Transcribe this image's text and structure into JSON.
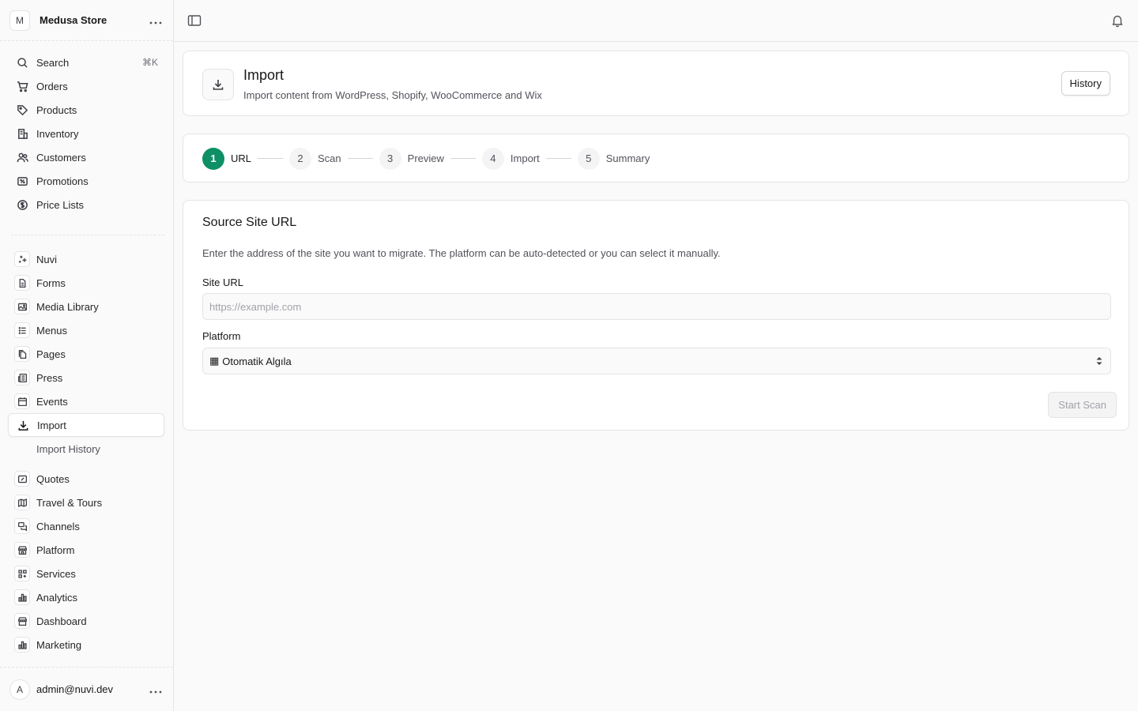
{
  "store": {
    "avatar_letter": "M",
    "name": "Medusa Store",
    "menu_icon": "ellipsis-icon"
  },
  "search": {
    "label": "Search",
    "shortcut": "⌘K"
  },
  "nav_main": [
    {
      "label": "Orders",
      "icon": "cart-icon"
    },
    {
      "label": "Products",
      "icon": "tag-icon"
    },
    {
      "label": "Inventory",
      "icon": "building-icon"
    },
    {
      "label": "Customers",
      "icon": "users-icon"
    },
    {
      "label": "Promotions",
      "icon": "receipt-percent-icon"
    },
    {
      "label": "Price Lists",
      "icon": "currency-dollar-icon"
    }
  ],
  "nav_extensions": [
    {
      "label": "Nuvi",
      "icon": "sparkles-icon"
    },
    {
      "label": "Forms",
      "icon": "document-icon"
    },
    {
      "label": "Media Library",
      "icon": "photo-icon"
    },
    {
      "label": "Menus",
      "icon": "list-bullet-icon"
    },
    {
      "label": "Pages",
      "icon": "documents-icon"
    },
    {
      "label": "Press",
      "icon": "newspaper-icon"
    },
    {
      "label": "Events",
      "icon": "calendar-icon"
    },
    {
      "label": "Import",
      "icon": "download-icon",
      "active": true
    }
  ],
  "nav_import_sub": "Import History",
  "nav_more": [
    {
      "label": "Quotes",
      "icon": "receipt-percent-icon"
    },
    {
      "label": "Travel & Tours",
      "icon": "map-icon"
    },
    {
      "label": "Channels",
      "icon": "chat-bubbles-icon"
    },
    {
      "label": "Platform",
      "icon": "building-storefront-icon"
    },
    {
      "label": "Services",
      "icon": "squares-plus-icon"
    },
    {
      "label": "Analytics",
      "icon": "chart-bar-icon"
    },
    {
      "label": "Dashboard",
      "icon": "building-storefront-icon"
    },
    {
      "label": "Marketing",
      "icon": "chart-bar-icon"
    }
  ],
  "user": {
    "avatar_letter": "A",
    "email": "admin@nuvi.dev"
  },
  "page_header": {
    "title": "Import",
    "subtitle": "Import content from WordPress, Shopify, WooCommerce and Wix",
    "history_button": "History"
  },
  "steps": [
    {
      "number": "1",
      "label": "URL",
      "active": true
    },
    {
      "number": "2",
      "label": "Scan"
    },
    {
      "number": "3",
      "label": "Preview"
    },
    {
      "number": "4",
      "label": "Import"
    },
    {
      "number": "5",
      "label": "Summary"
    }
  ],
  "form": {
    "title": "Source Site URL",
    "description": "Enter the address of the site you want to migrate. The platform can be auto-detected or you can select it manually.",
    "url_label": "Site URL",
    "url_placeholder": "https://example.com",
    "url_value": "",
    "platform_label": "Platform",
    "platform_selected": "Otomatik Algıla",
    "platform_icon": "▦",
    "start_button": "Start Scan"
  },
  "colors": {
    "accent": "#0e8f66",
    "border": "#e4e4e7",
    "background": "#fafafa"
  }
}
